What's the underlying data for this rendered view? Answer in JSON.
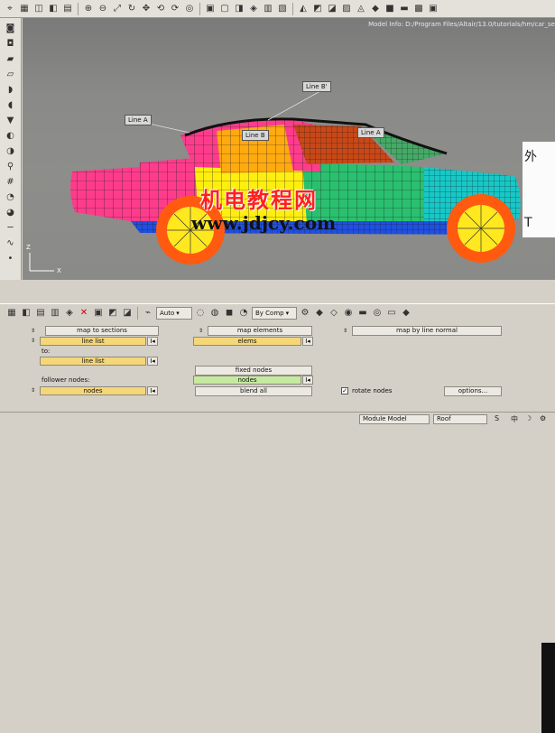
{
  "header": {
    "model_info": "Model Info: D:/Program Files/Altair/13.0/tutorials/hm/car_se"
  },
  "viewport": {
    "callouts": {
      "line_a_left": "Line A",
      "line_b_top": "Line B'",
      "line_b_mid": "Line B",
      "line_a_right": "Line A"
    },
    "watermark_cn": "机电教程网",
    "watermark_url": "www.jdjcy.com",
    "side_panel_char_1": "外",
    "side_panel_char_2": "T",
    "axis_label_z": "Z",
    "axis_label_x": "X"
  },
  "bottom_toolbar": {
    "auto_dropdown": "Auto",
    "color_dropdown": "By Comp"
  },
  "panel": {
    "map_to_sections": "map to sections",
    "line_list_1": "line list",
    "to_label": "to:",
    "line_list_2": "line list",
    "follower_nodes_label": "follower nodes:",
    "nodes_1": "nodes",
    "map_elements": "map elements",
    "elems": "elems",
    "fixed_nodes": "fixed nodes",
    "nodes_2": "nodes",
    "blend_all": "blend all",
    "map_by_line_normal": "map by line normal",
    "rotate_nodes": "rotate nodes",
    "options": "options..."
  },
  "status_bar": {
    "module": "Module Model",
    "root": "Roof"
  }
}
